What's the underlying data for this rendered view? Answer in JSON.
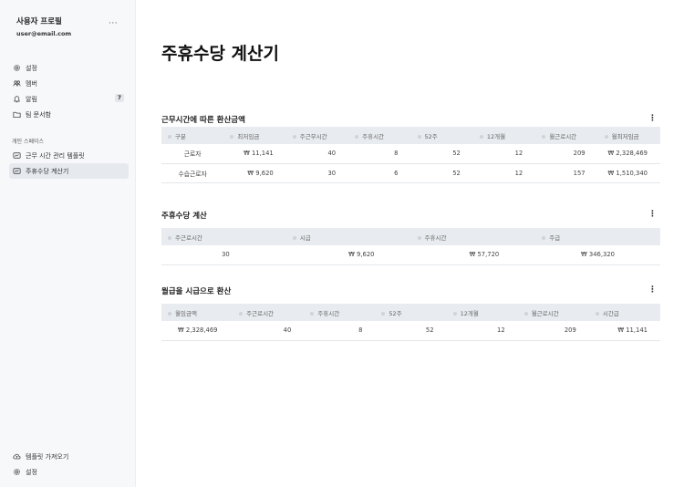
{
  "profile": {
    "name": "사용자 프로필",
    "email": "user@email.com",
    "more": "···"
  },
  "sidebar": {
    "items": [
      {
        "label": "설정",
        "icon": "gear-icon"
      },
      {
        "label": "멤버",
        "icon": "users-icon"
      },
      {
        "label": "알림",
        "icon": "bell-icon",
        "badge": "7"
      },
      {
        "label": "팀 문서함",
        "icon": "folder-icon"
      }
    ],
    "section_label": "개인 스페이스",
    "space_items": [
      {
        "label": "근무 시간 관리 템플릿",
        "icon": "document-icon"
      },
      {
        "label": "주휴수당 계산기",
        "icon": "document-icon",
        "active": true
      }
    ],
    "bottom_items": [
      {
        "label": "템플릿 가져오기",
        "icon": "cloud-icon"
      },
      {
        "label": "설정",
        "icon": "gear-icon"
      }
    ]
  },
  "page": {
    "title": "주휴수당 계산기"
  },
  "table1": {
    "title": "근무시간에 따른 환산금액",
    "headers": [
      "구분",
      "최저임금",
      "주근무시간",
      "주휴시간",
      "52주",
      "12개월",
      "월근로시간",
      "월최저임금"
    ],
    "rows": [
      [
        "근로자",
        "₩ 11,141",
        "40",
        "8",
        "52",
        "12",
        "209",
        "₩ 2,328,469"
      ],
      [
        "수습근로자",
        "₩ 9,620",
        "30",
        "6",
        "52",
        "12",
        "157",
        "₩ 1,510,340"
      ]
    ]
  },
  "table2": {
    "title": "주휴수당 계산",
    "headers": [
      "주근로시간",
      "시급",
      "주휴시간",
      "주급"
    ],
    "rows": [
      [
        "30",
        "₩ 9,620",
        "₩ 57,720",
        "₩ 346,320"
      ]
    ]
  },
  "table3": {
    "title": "월급을 시급으로 환산",
    "headers": [
      "월임금액",
      "주근로시간",
      "주휴시간",
      "52주",
      "12개월",
      "월근로시간",
      "시간급"
    ],
    "rows": [
      [
        "₩ 2,328,469",
        "40",
        "8",
        "52",
        "12",
        "209",
        "₩ 11,141"
      ]
    ]
  },
  "kebab": "⋮"
}
